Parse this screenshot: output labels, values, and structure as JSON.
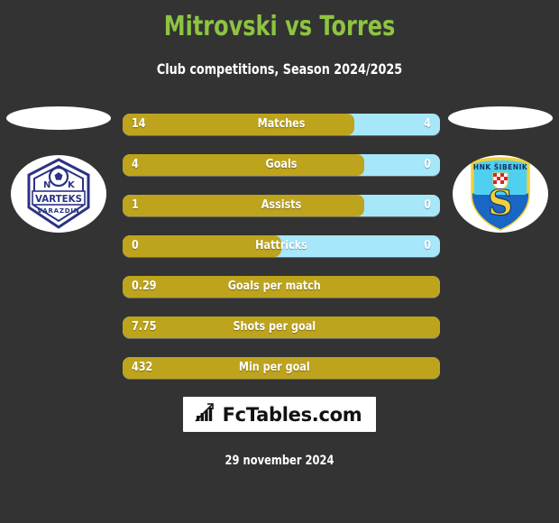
{
  "header": {
    "title": "Mitrovski vs Torres",
    "subtitle": "Club competitions, Season 2024/2025"
  },
  "teams": {
    "left": {
      "name": "NK Varteks Varazdin",
      "crest_line1": "N",
      "crest_line2": "K",
      "crest_main": "VARTEKS",
      "crest_sub": "VARAZDIN",
      "primary_color": "#2b3285",
      "bg_color": "#ffffff"
    },
    "right": {
      "name": "HNK Sibenik",
      "crest_top": "HNK ŠIBENIK",
      "crest_main": "S",
      "primary_color": "#1a66c4",
      "accent_color": "#4fd0f0",
      "border_color": "#f2d03b",
      "bg_color": "#ffffff"
    }
  },
  "colors": {
    "background": "#333333",
    "title_green": "#8dc442",
    "bar_gold": "#bda41c",
    "bar_blue": "#a6e7fa",
    "text_white": "#ffffff"
  },
  "stats": [
    {
      "label": "Matches",
      "left": "14",
      "right": "4",
      "fill_pct": 73,
      "split": true
    },
    {
      "label": "Goals",
      "left": "4",
      "right": "0",
      "fill_pct": 76,
      "split": true
    },
    {
      "label": "Assists",
      "left": "1",
      "right": "0",
      "fill_pct": 76,
      "split": true
    },
    {
      "label": "Hattricks",
      "left": "0",
      "right": "0",
      "fill_pct": 50,
      "split": true
    },
    {
      "label": "Goals per match",
      "left": "0.29",
      "right": "",
      "fill_pct": 100,
      "split": false
    },
    {
      "label": "Shots per goal",
      "left": "7.75",
      "right": "",
      "fill_pct": 100,
      "split": false
    },
    {
      "label": "Min per goal",
      "left": "432",
      "right": "",
      "fill_pct": 100,
      "split": false
    }
  ],
  "footer": {
    "brand": "FcTables.com",
    "brand_icon": "bar-chart-arrow-icon",
    "date": "29 november 2024"
  },
  "chart_data": {
    "type": "bar",
    "title": "Mitrovski vs Torres",
    "subtitle": "Club competitions, Season 2024/2025",
    "categories": [
      "Matches",
      "Goals",
      "Assists",
      "Hattricks",
      "Goals per match",
      "Shots per goal",
      "Min per goal"
    ],
    "series": [
      {
        "name": "Mitrovski",
        "values": [
          14,
          4,
          1,
          0,
          0.29,
          7.75,
          432
        ],
        "color": "#bda41c"
      },
      {
        "name": "Torres",
        "values": [
          4,
          0,
          0,
          0,
          null,
          null,
          null
        ],
        "color": "#a6e7fa"
      }
    ],
    "legend": [
      "Mitrovski",
      "Torres"
    ],
    "grid": false,
    "orientation": "horizontal-stacked"
  }
}
